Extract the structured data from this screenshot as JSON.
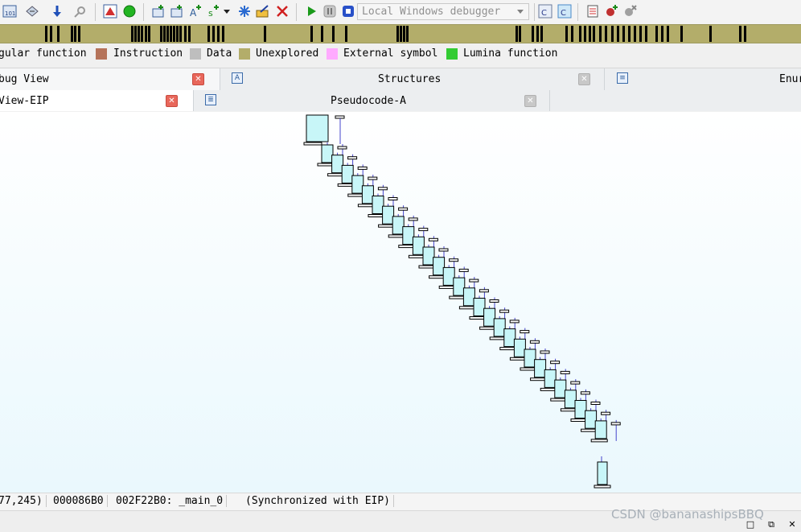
{
  "toolbar": {
    "debugger_label": "Local Windows debugger",
    "icons": [
      "hex-view-icon",
      "assemble-icon",
      "jump-down-icon",
      "search-icon",
      "warning-icon",
      "green-circle-icon",
      "add-code-icon",
      "add-data-icon",
      "add-string-icon",
      "add-struct-icon",
      "add-enum-icon",
      "edit-icon",
      "delete-icon",
      "play-icon",
      "pause-icon",
      "stop-icon",
      "attach-icon",
      "detach-icon",
      "breakpoint-list-icon",
      "add-breakpoint-icon",
      "remove-breakpoint-icon"
    ]
  },
  "legend": {
    "items": [
      {
        "label": "gular function",
        "color": null
      },
      {
        "label": "Instruction",
        "color": "#b5735a"
      },
      {
        "label": "Data",
        "color": "#bebebe"
      },
      {
        "label": "Unexplored",
        "color": "#b3ad6a"
      },
      {
        "label": "External symbol",
        "color": "#ffaaff"
      },
      {
        "label": "Lumina function",
        "color": "#33cc33"
      }
    ]
  },
  "tabs_row1": [
    {
      "label": "bug View"
    },
    {
      "label": "Structures"
    },
    {
      "label": "Enur"
    }
  ],
  "tabs_row2": [
    {
      "label": "View-EIP"
    },
    {
      "label": "Pseudocode-A"
    }
  ],
  "status": {
    "coords": "77,245)",
    "offset": "000086B0",
    "location": "002F22B0: _main_0",
    "sync": "(Synchronized with EIP)"
  },
  "watermark": "CSDN @bananashipsBBQ",
  "colors": {
    "nav_band": "#b3ad6a",
    "graph_node_fill": "#c8f6f8",
    "graph_edge": "#4444cc"
  }
}
